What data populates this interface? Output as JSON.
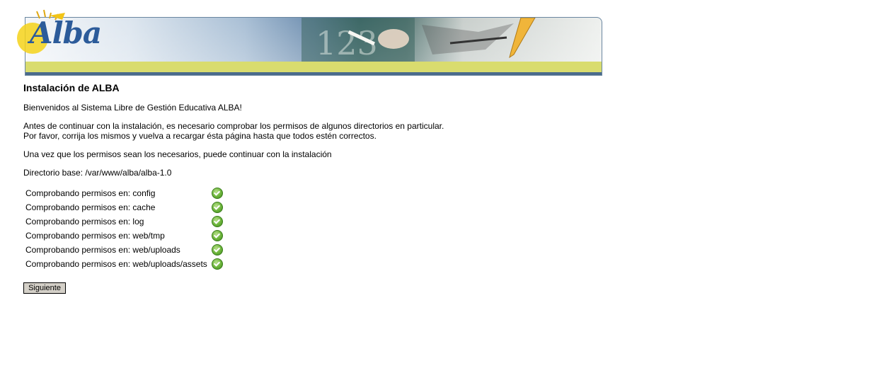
{
  "header": {
    "logo_text": "Alba",
    "banner_chalk_text": "123"
  },
  "main": {
    "title": "Instalación de ALBA",
    "welcome": "Bienvenidos al Sistema Libre de Gestión Educativa ALBA!",
    "instructions_line1": "Antes de continuar con la instalación, es necesario comprobar los permisos de algunos directorios en particular.",
    "instructions_line2": "Por favor, corrija los mismos y vuelva a recargar ésta página hasta que todos estén correctos.",
    "continue_note": "Una vez que los permisos sean los necesarios, puede continuar con la instalación",
    "base_dir": "Directorio base: /var/www/alba/alba-1.0",
    "checks": [
      {
        "label": "Comprobando permisos en: config",
        "status": "ok",
        "icon": "check-ok-icon"
      },
      {
        "label": "Comprobando permisos en: cache",
        "status": "ok",
        "icon": "check-ok-icon"
      },
      {
        "label": "Comprobando permisos en: log",
        "status": "ok",
        "icon": "check-ok-icon"
      },
      {
        "label": "Comprobando permisos en: web/tmp",
        "status": "ok",
        "icon": "check-ok-icon"
      },
      {
        "label": "Comprobando permisos en: web/uploads",
        "status": "ok",
        "icon": "check-ok-icon"
      },
      {
        "label": "Comprobando permisos en: web/uploads/assets",
        "status": "ok",
        "icon": "check-ok-icon"
      }
    ],
    "next_button": "Siguiente"
  },
  "colors": {
    "banner_yellow": "#d9dc6e",
    "banner_blue": "#4a6b8c",
    "logo_blue": "#2c5b9a",
    "ok_green": "#6bb43a",
    "button_gray": "#d4d0c8"
  }
}
